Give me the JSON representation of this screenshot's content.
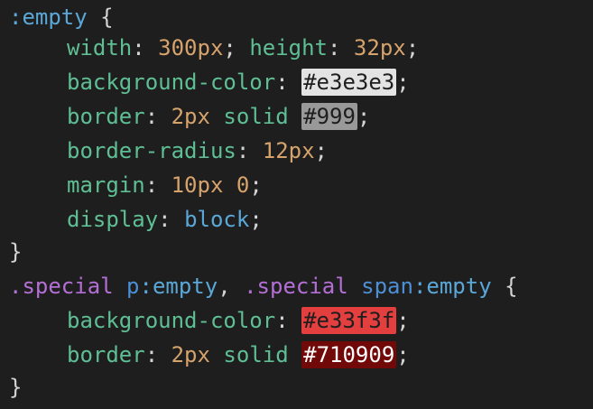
{
  "editor": {
    "background": "#1e1e1e",
    "lines": {
      "l1": {
        "selector": ":empty",
        "brace": " {"
      },
      "l2": {
        "p1": "width",
        "sep1": ": ",
        "v1": "300px",
        "semi1": "; ",
        "p2": "height",
        "sep2": ": ",
        "v2": "32px",
        "semi2": ";"
      },
      "l3": {
        "prop": "background-color",
        "sep": ": ",
        "value": "#e3e3e3",
        "semi": ";"
      },
      "l4": {
        "prop": "border",
        "sep": ": ",
        "v1": "2px",
        "v2": "solid",
        "color": "#999",
        "semi": ";"
      },
      "l5": {
        "prop": "border-radius",
        "sep": ": ",
        "value": "12px",
        "semi": ";"
      },
      "l6": {
        "prop": "margin",
        "sep": ": ",
        "v1": "10px",
        "v2": "0",
        "semi": ";"
      },
      "l7": {
        "prop": "display",
        "sep": ": ",
        "value": "block",
        "semi": ";"
      },
      "l8": {
        "brace": "}"
      },
      "l9": {
        "c1": ".special",
        "t1": "p",
        "ps1": ":empty",
        "comma": ", ",
        "c2": ".special",
        "t2": "span",
        "ps2": ":empty",
        "brace": " {"
      },
      "l10": {
        "prop": "background-color",
        "sep": ": ",
        "value": "#e33f3f",
        "semi": ";"
      },
      "l11": {
        "prop": "border",
        "sep": ": ",
        "v1": "2px",
        "v2": "solid",
        "color": "#710909",
        "semi": ";"
      },
      "l12": {
        "brace": "}"
      }
    }
  }
}
